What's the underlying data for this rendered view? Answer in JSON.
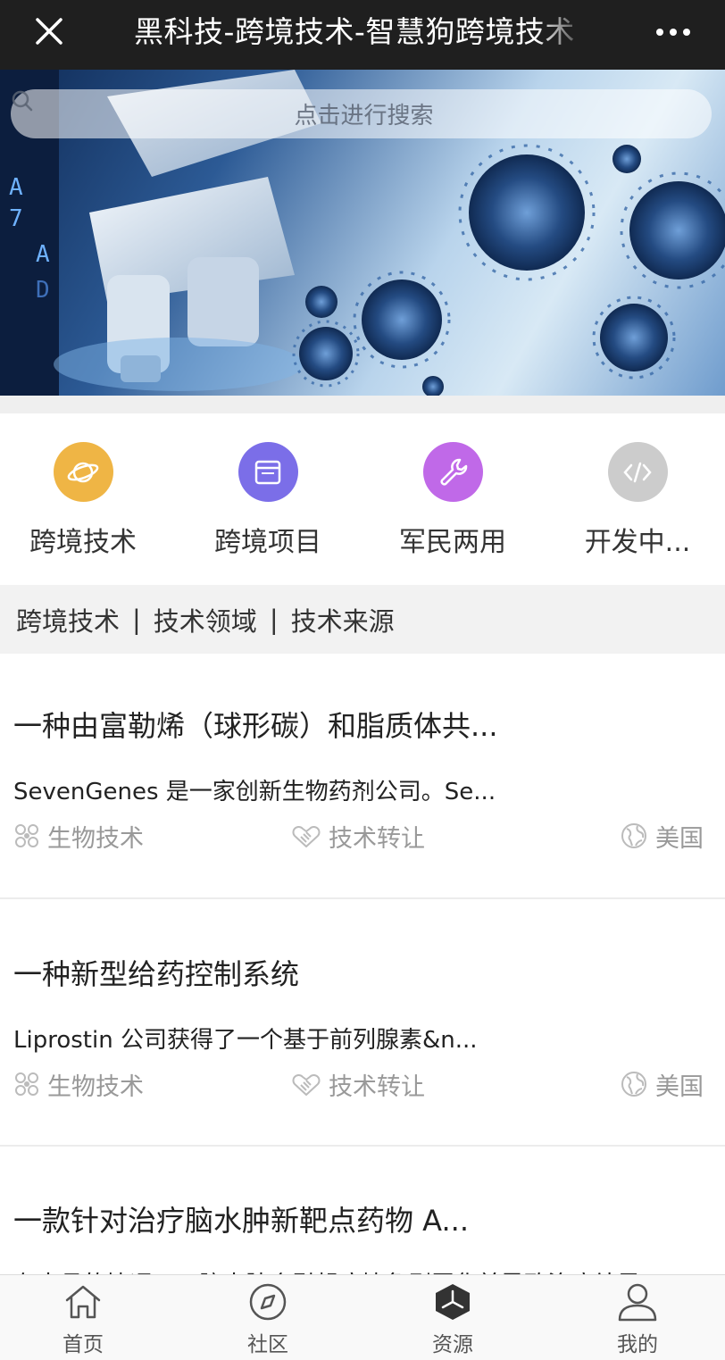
{
  "navbar": {
    "title": "黑科技-跨境技术-智慧狗跨境技术",
    "close_icon": "close-icon",
    "more_icon": "more-dots-icon"
  },
  "banner": {
    "image": "microscope-virus-illustration",
    "search_placeholder": "点击进行搜索"
  },
  "categories": [
    {
      "label": "跨境技术",
      "icon": "planet-icon",
      "color": "#efb545"
    },
    {
      "label": "跨境项目",
      "icon": "window-icon",
      "color": "#7b6ee8"
    },
    {
      "label": "军民两用",
      "icon": "wrench-icon",
      "color": "#c069e8"
    },
    {
      "label": "开发中...",
      "icon": "code-icon",
      "color": "#cccccc"
    }
  ],
  "filters": [
    "跨境技术",
    "技术领域",
    "技术来源"
  ],
  "filter_separator": "|",
  "articles": [
    {
      "title": "一种由富勒烯（球形碳）和脂质体共...",
      "desc": "SevenGenes 是一家创新生物药剂公司。Se...",
      "field": "生物技术",
      "type": "技术转让",
      "country": "美国"
    },
    {
      "title": "一种新型给药控制系统",
      "desc": "Liprostin 公司获得了一个基于前列腺素&n...",
      "field": "生物技术",
      "type": "技术转让",
      "country": "美国"
    },
    {
      "title": "一款针对治疗脑水肿新靶点药物 A...",
      "desc": "在大月的情况下，脑水肿会引起病情急剧恶化并导致治疗结果",
      "field": "",
      "type": "",
      "country": ""
    }
  ],
  "tabs": [
    {
      "label": "首页",
      "icon": "home-icon"
    },
    {
      "label": "社区",
      "icon": "compass-icon"
    },
    {
      "label": "资源",
      "icon": "resource-cube-icon"
    },
    {
      "label": "我的",
      "icon": "user-icon"
    }
  ]
}
